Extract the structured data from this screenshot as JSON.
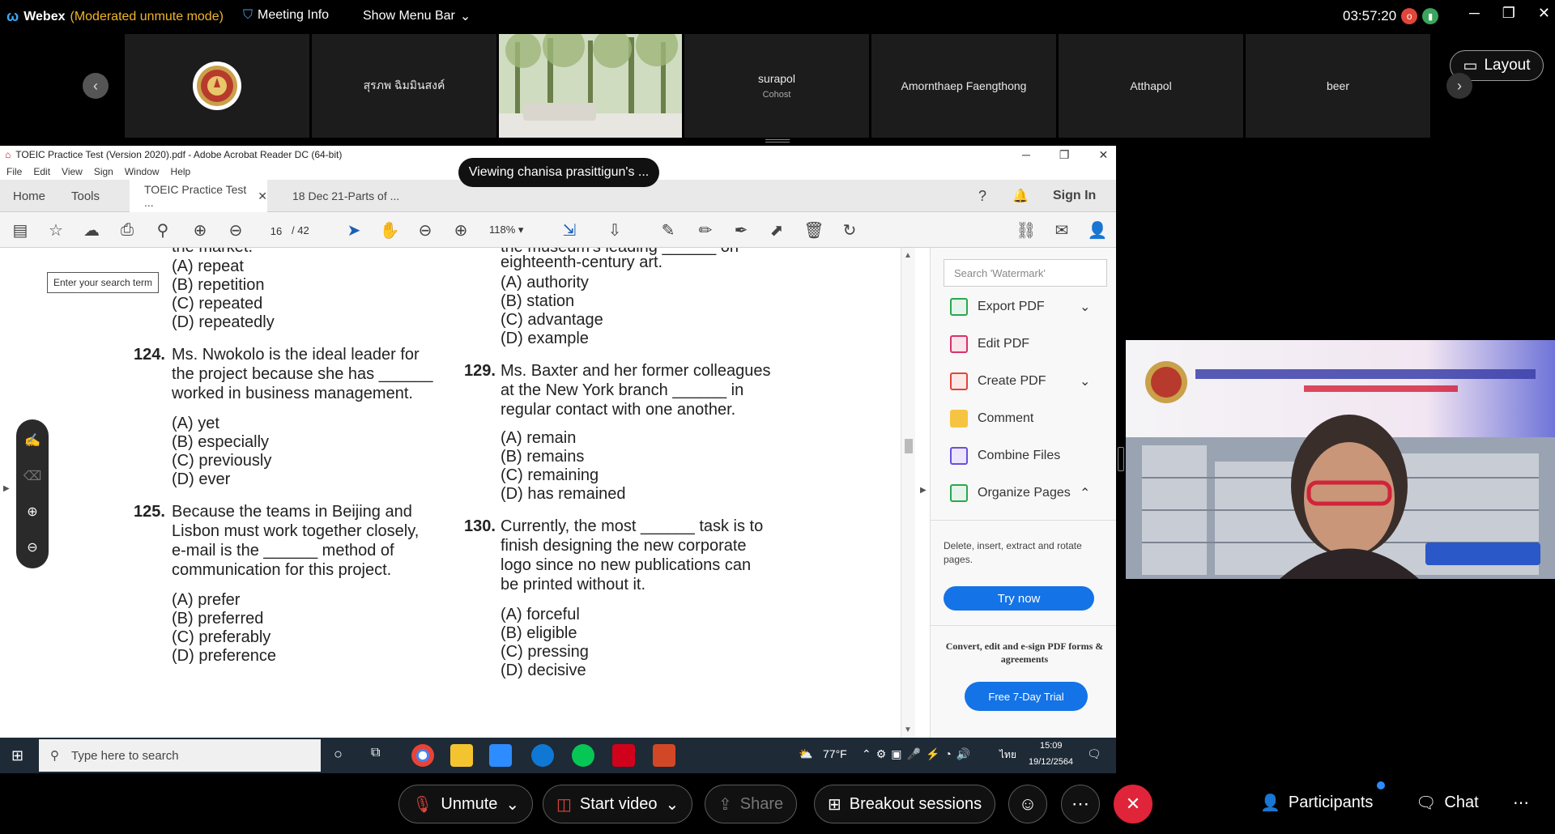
{
  "topbar": {
    "app_name": "Webex",
    "mode": "(Moderated unmute mode)",
    "meeting_info": "Meeting Info",
    "show_menu_bar": "Show Menu Bar",
    "time": "03:57:20",
    "rec_badge": "o"
  },
  "filmstrip": {
    "tiles": [
      {
        "name": "",
        "sub": ""
      },
      {
        "name": "สุรภพ ฉิมมินสงค์",
        "sub": ""
      },
      {
        "name": "",
        "sub": ""
      },
      {
        "name": "surapol",
        "sub": "Cohost"
      },
      {
        "name": "Amornthaep Faengthong",
        "sub": ""
      },
      {
        "name": "Atthapol",
        "sub": ""
      },
      {
        "name": "beer",
        "sub": ""
      }
    ],
    "layout_label": "Layout"
  },
  "viewing_banner": "Viewing chanisa prasittigun's ...",
  "acrobat": {
    "title": "TOEIC Practice Test (Version 2020).pdf - Adobe Acrobat Reader DC (64-bit)",
    "menu": [
      "File",
      "Edit",
      "View",
      "Sign",
      "Window",
      "Help"
    ],
    "tabs": {
      "home": "Home",
      "tools": "Tools",
      "doc1": "TOEIC Practice Test ...",
      "doc2": "18 Dec 21-Parts of ..."
    },
    "sign_in": "Sign In",
    "page_current": "16",
    "page_total": "/ 42",
    "zoom": "118%",
    "search_term": "Enter your search term"
  },
  "document": {
    "col1_top_options": [
      "(A) repeat",
      "(B) repetition",
      "(C) repeated",
      "(D) repeatedly"
    ],
    "q124": {
      "num": "124.",
      "lines": [
        "Ms. Nwokolo is the ideal leader for",
        "the project because she has ______",
        "worked in business management."
      ],
      "options": [
        "(A) yet",
        "(B) especially",
        "(C) previously",
        "(D) ever"
      ]
    },
    "q125": {
      "num": "125.",
      "lines": [
        "Because the teams in Beijing and",
        "Lisbon must work together closely,",
        "e-mail is the ______ method of",
        "communication for this project."
      ],
      "options": [
        "(A) prefer",
        "(B) preferred",
        "(C) preferably",
        "(D) preference"
      ]
    },
    "col2_top_line": "eighteenth-century art.",
    "col2_top_options": [
      "(A) authority",
      "(B) station",
      "(C) advantage",
      "(D) example"
    ],
    "q129": {
      "num": "129.",
      "lines": [
        "Ms. Baxter and her former colleagues",
        "at the New York branch ______ in",
        "regular contact with one another."
      ],
      "options": [
        "(A) remain",
        "(B) remains",
        "(C) remaining",
        "(D) has remained"
      ]
    },
    "q130": {
      "num": "130.",
      "lines": [
        "Currently, the most ______ task is to",
        "finish designing the new corporate",
        "logo since no new publications can",
        "be printed without it."
      ],
      "options": [
        "(A) forceful",
        "(B) eligible",
        "(C) pressing",
        "(D) decisive"
      ]
    }
  },
  "right_pane": {
    "search_placeholder": "Search 'Watermark'",
    "items": [
      "Export PDF",
      "Edit PDF",
      "Create PDF",
      "Comment",
      "Combine Files",
      "Organize Pages"
    ],
    "description": "Delete, insert, extract and rotate pages.",
    "try_now": "Try now",
    "convert_text": "Convert, edit and e-sign PDF forms & agreements",
    "trial_button": "Free 7-Day Trial"
  },
  "taskbar": {
    "search": "Type here to search",
    "temp": "77°F",
    "lang": "ไทย",
    "time": "15:09",
    "date": "19/12/2564"
  },
  "controls": {
    "unmute": "Unmute",
    "start_video": "Start video",
    "share": "Share",
    "breakout": "Breakout sessions",
    "participants": "Participants",
    "chat": "Chat"
  }
}
